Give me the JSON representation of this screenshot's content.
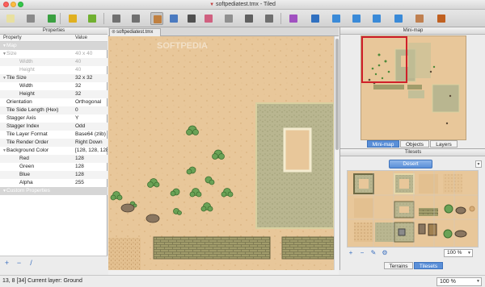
{
  "window": {
    "title": "softpediatest.tmx - Tiled"
  },
  "toolbar": {
    "buttons": [
      {
        "name": "new-map",
        "icon": "new-file-icon",
        "color": "#e8e0a0"
      },
      {
        "name": "open",
        "icon": "open-folder-icon",
        "color": "#8a8a8a"
      },
      {
        "name": "save",
        "icon": "save-icon",
        "color": "#3aa040"
      },
      {
        "name": "undo",
        "icon": "undo-icon",
        "color": "#e0b020"
      },
      {
        "name": "redo",
        "icon": "redo-icon",
        "color": "#70b030"
      },
      {
        "name": "command",
        "icon": "gear-icon",
        "color": "#707070"
      },
      {
        "name": "random",
        "icon": "dice-icon",
        "color": "#707070"
      },
      {
        "name": "stamp",
        "icon": "stamp-brush-icon",
        "color": "#c08040"
      },
      {
        "name": "terrain",
        "icon": "terrain-brush-icon",
        "color": "#4a7ac0"
      },
      {
        "name": "bucket",
        "icon": "bucket-fill-icon",
        "color": "#505050"
      },
      {
        "name": "eraser",
        "icon": "eraser-icon",
        "color": "#d06080"
      },
      {
        "name": "rect-select",
        "icon": "rectangle-select-icon",
        "color": "#909090"
      },
      {
        "name": "magic-wand",
        "icon": "magic-wand-icon",
        "color": "#606060"
      },
      {
        "name": "same-tile",
        "icon": "select-same-tile-icon",
        "color": "#707070"
      },
      {
        "name": "select-objects",
        "icon": "select-objects-icon",
        "color": "#a050c0"
      },
      {
        "name": "edit-polygons",
        "icon": "edit-polygons-icon",
        "color": "#3070c0"
      },
      {
        "name": "rectangle",
        "icon": "insert-rectangle-icon",
        "color": "#3a8ad8"
      },
      {
        "name": "ellipse",
        "icon": "insert-ellipse-icon",
        "color": "#3a8ad8"
      },
      {
        "name": "polygon",
        "icon": "insert-polygon-icon",
        "color": "#3a8ad8"
      },
      {
        "name": "polyline",
        "icon": "insert-polyline-icon",
        "color": "#3a8ad8"
      },
      {
        "name": "tile-object",
        "icon": "insert-tile-icon",
        "color": "#c08050"
      },
      {
        "name": "text",
        "icon": "insert-text-icon",
        "color": "#c06020"
      }
    ]
  },
  "properties": {
    "panel_title": "Properties",
    "col_property": "Property",
    "col_value": "Value",
    "rows": [
      {
        "key": "Map",
        "value": "",
        "type": "group"
      },
      {
        "key": "Size",
        "value": "40 x 40",
        "type": "disabled-parent"
      },
      {
        "key": "Width",
        "value": "40",
        "type": "disabled-child"
      },
      {
        "key": "Height",
        "value": "40",
        "type": "disabled-child"
      },
      {
        "key": "Tile Size",
        "value": "32 x 32",
        "type": "parent"
      },
      {
        "key": "Width",
        "value": "32",
        "type": "child"
      },
      {
        "key": "Height",
        "value": "32",
        "type": "child"
      },
      {
        "key": "Orientation",
        "value": "Orthogonal",
        "type": "normal"
      },
      {
        "key": "Tile Side Length (Hex)",
        "value": "0",
        "type": "normal"
      },
      {
        "key": "Stagger Axis",
        "value": "Y",
        "type": "normal"
      },
      {
        "key": "Stagger Index",
        "value": "Odd",
        "type": "normal"
      },
      {
        "key": "Tile Layer Format",
        "value": "Base64 (zlib)",
        "type": "normal"
      },
      {
        "key": "Tile Render Order",
        "value": "Right Down",
        "type": "normal"
      },
      {
        "key": "Background Color",
        "value": "[128, 128, 128, 255]",
        "type": "parent"
      },
      {
        "key": "Red",
        "value": "128",
        "type": "child"
      },
      {
        "key": "Green",
        "value": "128",
        "type": "child"
      },
      {
        "key": "Blue",
        "value": "128",
        "type": "child"
      },
      {
        "key": "Alpha",
        "value": "255",
        "type": "child"
      },
      {
        "key": "Custom Properties",
        "value": "",
        "type": "group"
      }
    ],
    "bottom_buttons": [
      "+",
      "−",
      "/"
    ]
  },
  "map_tab": {
    "label": "softpediatest.tmx"
  },
  "watermark": "SOFTPEDIA",
  "minimap": {
    "panel_title": "Mini-map",
    "tabs": [
      {
        "label": "Mini-map",
        "selected": true
      },
      {
        "label": "Objects",
        "selected": false
      },
      {
        "label": "Layers",
        "selected": false
      }
    ]
  },
  "tilesets": {
    "panel_title": "Tilesets",
    "active_tileset": "Desert",
    "zoom": "100 %",
    "tool_buttons": [
      "+",
      "−",
      "✎",
      "⚙"
    ],
    "tabs": [
      {
        "label": "Terrains",
        "selected": false
      },
      {
        "label": "Tilesets",
        "selected": true
      }
    ]
  },
  "status": {
    "text": "13, 8 [34]  Current layer: Ground",
    "zoom": "100 %"
  },
  "colors": {
    "sand": "#e8c79a",
    "stone": "#b9b690",
    "brick": "#a19c6b",
    "selection": "#d0202a",
    "accent": "#5a8fd8"
  }
}
